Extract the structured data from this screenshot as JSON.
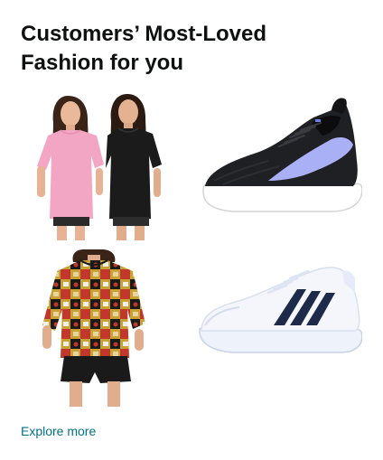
{
  "card": {
    "title_line_1": "Customers’ Most-Loved",
    "title_line_2": "Fashion for you",
    "explore_label": "Explore more"
  },
  "tiles": [
    {
      "product": "women-oversized-tshirts",
      "icon": "oversized-tshirt-models-image",
      "colors": [
        "#f3a6c4",
        "#1b1b1b"
      ]
    },
    {
      "product": "black-lavender-running-shoe",
      "icon": "running-shoe-image",
      "colors": [
        "#1f2023",
        "#aab0f5",
        "#ffffff"
      ]
    },
    {
      "product": "printed-oversized-tshirt",
      "icon": "printed-tshirt-model-image",
      "colors": [
        "#c8a233",
        "#c2372b",
        "#1a1a1a"
      ]
    },
    {
      "product": "white-striped-sneaker",
      "icon": "white-sneaker-image",
      "colors": [
        "#eef2fb",
        "#1d2a4a"
      ]
    }
  ],
  "colors": {
    "title": "#0f1111",
    "link": "#007185",
    "background": "#ffffff"
  }
}
